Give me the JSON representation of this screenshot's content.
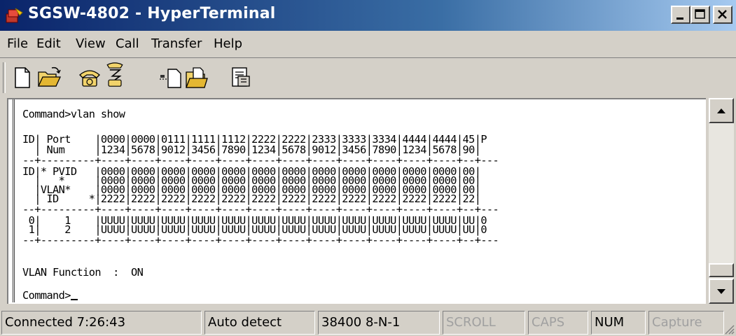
{
  "window": {
    "title": "SGSW-4802 - HyperTerminal",
    "colors": {
      "titlebar": "#0a246a",
      "face": "#d4d0c8",
      "terminal_bg": "#ffffff"
    }
  },
  "menu": [
    "File",
    "Edit",
    "View",
    "Call",
    "Transfer",
    "Help"
  ],
  "toolbar": {
    "icons": [
      "new-icon",
      "open-icon",
      "call-icon",
      "disconnect-icon",
      "send-icon",
      "receive-icon",
      "properties-icon"
    ]
  },
  "terminal": {
    "lines": [
      "Command>vlan show",
      "",
      "ID| Port    |0000|0000|0111|1111|1112|2222|2222|2333|3333|3334|4444|4444|45|P",
      "  | Num     |1234|5678|9012|3456|7890|1234|5678|9012|3456|7890|1234|5678|90|",
      "--+---------+----+----+----+----+----+----+----+----+----+----+----+----+--+---",
      "ID|* PVID   |0000|0000|0000|0000|0000|0000|0000|0000|0000|0000|0000|0000|00|",
      "  |   *     |0000|0000|0000|0000|0000|0000|0000|0000|0000|0000|0000|0000|00|",
      "  |VLAN*    |0000|0000|0000|0000|0000|0000|0000|0000|0000|0000|0000|0000|00|",
      "  | ID     *|2222|2222|2222|2222|2222|2222|2222|2222|2222|2222|2222|2222|22|",
      "--+---------+----+----+----+----+----+----+----+----+----+----+----+----+--+---",
      " 0|    1    |UUUU|UUUU|UUUU|UUUU|UUUU|UUUU|UUUU|UUUU|UUUU|UUUU|UUUU|UUUU|UU|0",
      " 1|    2    |UUUU|UUUU|UUUU|UUUU|UUUU|UUUU|UUUU|UUUU|UUUU|UUUU|UUUU|UUUU|UU|0",
      "--+---------+----+----+----+----+----+----+----+----+----+----+----+----+--+---",
      "",
      "VLAN Function  :  ON",
      "",
      "Command>"
    ]
  },
  "status": {
    "connected": "Connected 7:26:43",
    "detect": "Auto detect",
    "settings": "38400 8-N-1",
    "scroll": "SCROLL",
    "caps": "CAPS",
    "num": "NUM",
    "capture": "Capture"
  }
}
